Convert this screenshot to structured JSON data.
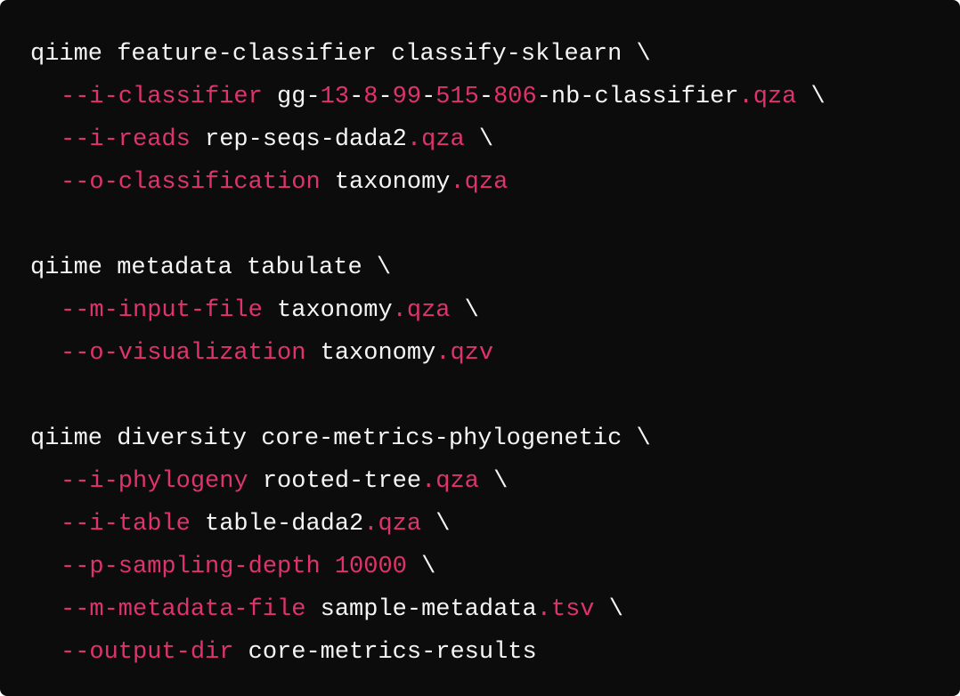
{
  "theme": {
    "background": "#0c0c0c",
    "text": "#f5f5f5",
    "accent": "#e0336b"
  },
  "code": {
    "language": "bash",
    "lines": [
      {
        "indent": false,
        "tokens": [
          {
            "t": "qiime feature-classifier classify-sklearn \\",
            "k": "plain"
          }
        ]
      },
      {
        "indent": true,
        "tokens": [
          {
            "t": "--i-classifier",
            "k": "flag"
          },
          {
            "t": " gg-",
            "k": "plain"
          },
          {
            "t": "13",
            "k": "num"
          },
          {
            "t": "-",
            "k": "plain"
          },
          {
            "t": "8",
            "k": "num"
          },
          {
            "t": "-",
            "k": "plain"
          },
          {
            "t": "99",
            "k": "num"
          },
          {
            "t": "-",
            "k": "plain"
          },
          {
            "t": "515",
            "k": "num"
          },
          {
            "t": "-",
            "k": "plain"
          },
          {
            "t": "806",
            "k": "num"
          },
          {
            "t": "-nb-classifier",
            "k": "plain"
          },
          {
            "t": ".qza",
            "k": "ext"
          },
          {
            "t": " \\",
            "k": "plain"
          }
        ]
      },
      {
        "indent": true,
        "tokens": [
          {
            "t": "--i-reads",
            "k": "flag"
          },
          {
            "t": " rep-seqs-dada2",
            "k": "plain"
          },
          {
            "t": ".qza",
            "k": "ext"
          },
          {
            "t": " \\",
            "k": "plain"
          }
        ]
      },
      {
        "indent": true,
        "tokens": [
          {
            "t": "--o-classification",
            "k": "flag"
          },
          {
            "t": " taxonomy",
            "k": "plain"
          },
          {
            "t": ".qza",
            "k": "ext"
          }
        ]
      },
      {
        "blank": true,
        "tokens": []
      },
      {
        "indent": false,
        "tokens": [
          {
            "t": "qiime metadata tabulate \\",
            "k": "plain"
          }
        ]
      },
      {
        "indent": true,
        "tokens": [
          {
            "t": "--m-input-file",
            "k": "flag"
          },
          {
            "t": " taxonomy",
            "k": "plain"
          },
          {
            "t": ".qza",
            "k": "ext"
          },
          {
            "t": " \\",
            "k": "plain"
          }
        ]
      },
      {
        "indent": true,
        "tokens": [
          {
            "t": "--o-visualization",
            "k": "flag"
          },
          {
            "t": " taxonomy",
            "k": "plain"
          },
          {
            "t": ".qzv",
            "k": "ext"
          }
        ]
      },
      {
        "blank": true,
        "tokens": []
      },
      {
        "indent": false,
        "tokens": [
          {
            "t": "qiime diversity core-metrics-phylogenetic \\",
            "k": "plain"
          }
        ]
      },
      {
        "indent": true,
        "tokens": [
          {
            "t": "--i-phylogeny",
            "k": "flag"
          },
          {
            "t": " rooted-tree",
            "k": "plain"
          },
          {
            "t": ".qza",
            "k": "ext"
          },
          {
            "t": " \\",
            "k": "plain"
          }
        ]
      },
      {
        "indent": true,
        "tokens": [
          {
            "t": "--i-table",
            "k": "flag"
          },
          {
            "t": " table-dada2",
            "k": "plain"
          },
          {
            "t": ".qza",
            "k": "ext"
          },
          {
            "t": " \\",
            "k": "plain"
          }
        ]
      },
      {
        "indent": true,
        "tokens": [
          {
            "t": "--p-sampling-depth",
            "k": "flag"
          },
          {
            "t": " ",
            "k": "plain"
          },
          {
            "t": "10000",
            "k": "num"
          },
          {
            "t": " \\",
            "k": "plain"
          }
        ]
      },
      {
        "indent": true,
        "tokens": [
          {
            "t": "--m-metadata-file",
            "k": "flag"
          },
          {
            "t": " sample-metadata",
            "k": "plain"
          },
          {
            "t": ".tsv",
            "k": "ext"
          },
          {
            "t": " \\",
            "k": "plain"
          }
        ]
      },
      {
        "indent": true,
        "tokens": [
          {
            "t": "--output-dir",
            "k": "flag"
          },
          {
            "t": " core-metrics-results",
            "k": "plain"
          }
        ]
      }
    ]
  }
}
